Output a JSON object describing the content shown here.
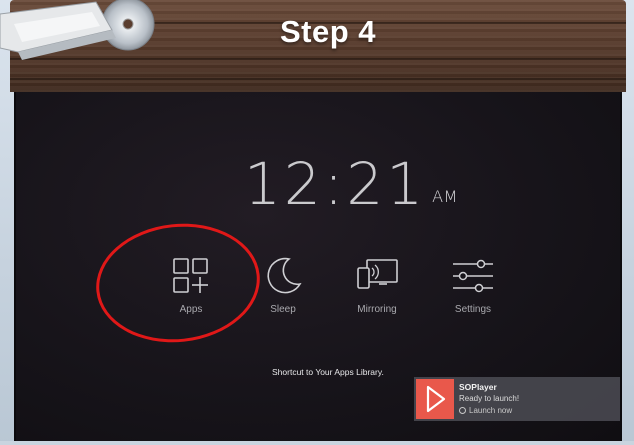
{
  "tutorial": {
    "step_title": "Step 4"
  },
  "home_screen": {
    "clock": {
      "time": "12:21",
      "period": "AM"
    },
    "menu": [
      {
        "label": "Apps",
        "icon": "apps-grid-icon"
      },
      {
        "label": "Sleep",
        "icon": "moon-icon"
      },
      {
        "label": "Mirroring",
        "icon": "mirroring-icon"
      },
      {
        "label": "Settings",
        "icon": "settings-sliders-icon"
      }
    ],
    "hint": "Shortcut to Your Apps Library.",
    "highlighted_item": "Apps"
  },
  "notification": {
    "app_name": "SOPlayer",
    "message": "Ready to launch!",
    "action": "Launch now",
    "logo_color": "#e9584b"
  },
  "colors": {
    "highlight_circle": "#e01818",
    "wood": "#5a3d2e",
    "screen_bg": "#17141a"
  }
}
